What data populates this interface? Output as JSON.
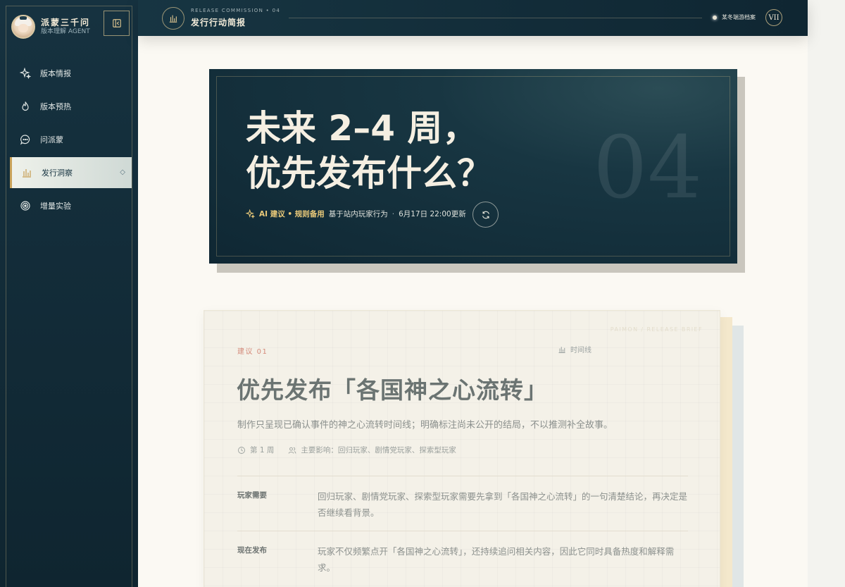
{
  "brand": {
    "title": "派蒙三千问",
    "subtitle": "版本理解 AGENT"
  },
  "sidebar": {
    "items": [
      {
        "label": "版本情报",
        "icon": "sparkle-icon"
      },
      {
        "label": "版本预热",
        "icon": "flame-icon"
      },
      {
        "label": "问派蒙",
        "icon": "chat-bubble-icon"
      },
      {
        "label": "发行洞察",
        "icon": "bar-chart-icon",
        "active": true
      },
      {
        "label": "增量实验",
        "icon": "target-icon"
      }
    ]
  },
  "topbar": {
    "kicker": "RELEASE COMMISSION • 04",
    "title": "发行行动简报",
    "status": "某冬端游档案",
    "badge": "VII"
  },
  "hero": {
    "title_line1": "未来 2–4 周，",
    "title_line2": "优先发布什么？",
    "number": "04",
    "ai_label": "AI 建议 • 规则备用",
    "basis": "基于站内玩家行为",
    "updated": "6月17日 22:00更新"
  },
  "card": {
    "watermark": "PAIMON / RELEASE BRIEF",
    "kicker": "建议 01",
    "timeline_label": "时间线",
    "title": "优先发布「各国神之心流转」",
    "description": "制作只呈现已确认事件的神之心流转时间线；明确标注尚未公开的结局，不以推测补全故事。",
    "week": "第 1 周",
    "impact": "主要影响：回归玩家、剧情党玩家、探索型玩家",
    "rows": [
      {
        "label": "玩家需要",
        "text": "回归玩家、剧情党玩家、探索型玩家需要先拿到「各国神之心流转」的一句清楚结论，再决定是否继续看背景。"
      },
      {
        "label": "现在发布",
        "text": "玩家不仅频繁点开「各国神之心流转」，还持续追问相关内容，因此它同时具备热度和解释需求。"
      }
    ]
  },
  "colors": {
    "accent_gold": "#c9a25a",
    "dark_teal": "#163240",
    "kicker_red": "#d48a7a"
  }
}
